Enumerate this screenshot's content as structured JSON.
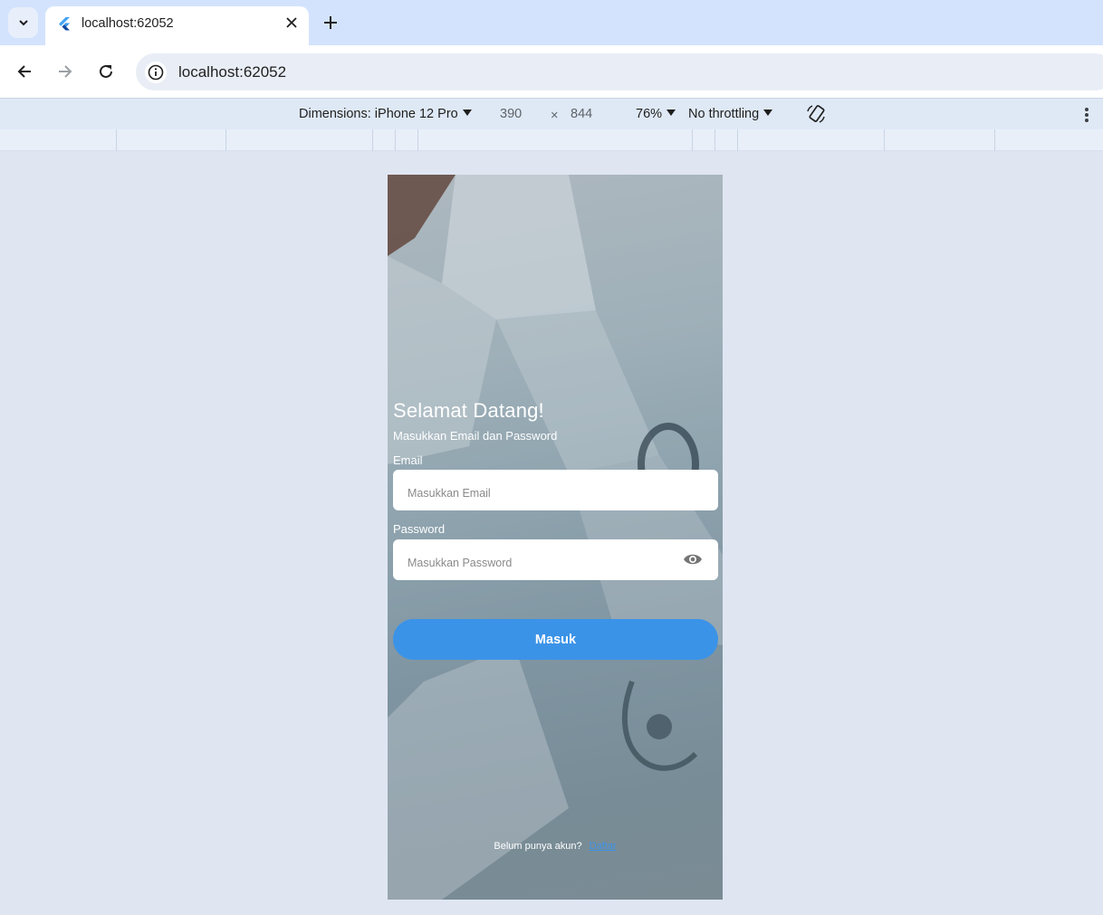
{
  "browser": {
    "tab": {
      "title": "localhost:62052"
    },
    "address_bar": {
      "url": "localhost:62052"
    }
  },
  "device_toolbar": {
    "dimensions_label": "Dimensions: iPhone 12 Pro",
    "width": "390",
    "times": "×",
    "height": "844",
    "zoom": "76%",
    "throttling": "No throttling"
  },
  "login": {
    "title": "Selamat Datang!",
    "subtitle": "Masukkan Email dan Password",
    "email_label": "Email",
    "email_placeholder": "Masukkan Email",
    "password_label": "Password",
    "password_placeholder": "Masukkan Password",
    "submit_label": "Masuk",
    "register_prompt": "Belum punya akun?",
    "register_link": "Daftar"
  },
  "colors": {
    "primary": "#3b93e7",
    "browser_tabstrip": "#d3e3fd",
    "page_background": "#dfe6f2"
  }
}
